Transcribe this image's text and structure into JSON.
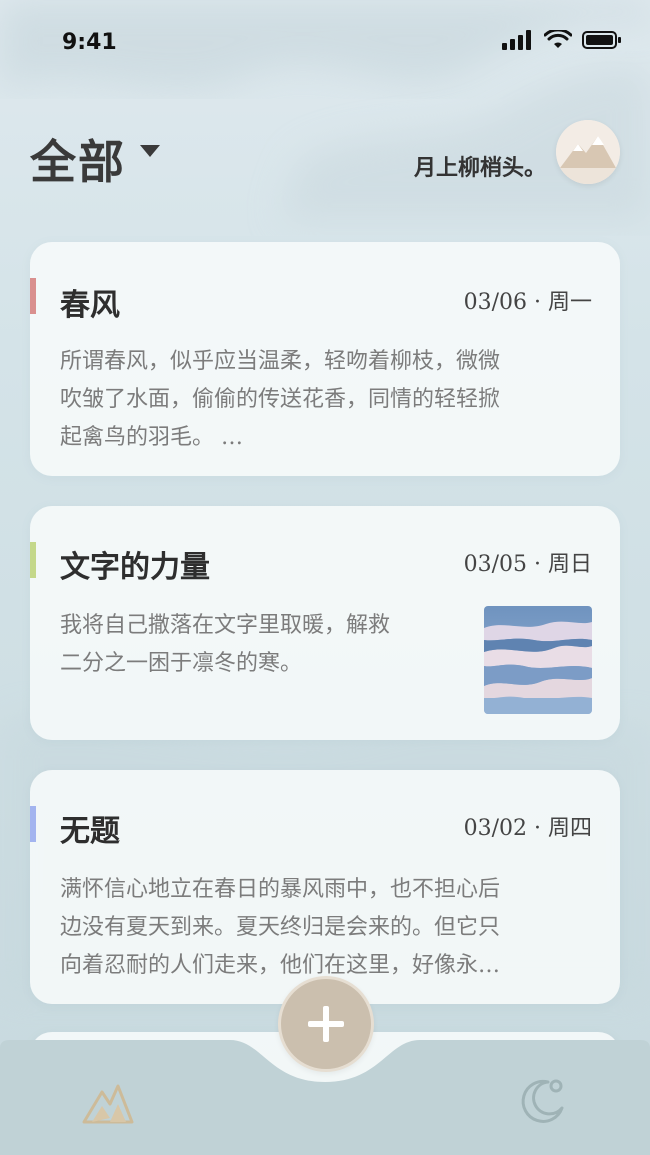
{
  "status_bar": {
    "time": "9:41"
  },
  "header": {
    "title": "全部",
    "motto": "月上柳梢头。"
  },
  "entries": [
    {
      "title": "春风",
      "date": "03/06 · 周一",
      "accent_color": "#d9908f",
      "body_lines": [
        "所谓春风，似乎应当温柔，轻吻着柳枝，微微",
        "吹皱了水面，偷偷的传送花香，同情的轻轻掀",
        "起禽鸟的羽毛。 …"
      ]
    },
    {
      "title": "文字的力量",
      "date": "03/05 · 周日",
      "accent_color": "#c4d88a",
      "body_lines": [
        "我将自己撒落在文字里取暖，解救",
        "二分之一困于凛冬的寒。"
      ],
      "thumbnail": "snow-dunes-image"
    },
    {
      "title": "无题",
      "date": "03/02 · 周四",
      "accent_color": "#a3b4ef",
      "body_lines": [
        "满怀信心地立在春日的暴风雨中，也不担心后",
        "边没有夏天到来。夏天终归是会来的。但它只",
        "向着忍耐的人们走来，他们在这里，好像永…"
      ]
    }
  ],
  "icons": {
    "fab": "plus-icon",
    "nav_left": "mountain-icon",
    "nav_right": "moon-icon"
  },
  "colors": {
    "fab": "#cbbfae",
    "nav_left": "#cdbb99",
    "nav_right": "#9fb3b6"
  }
}
